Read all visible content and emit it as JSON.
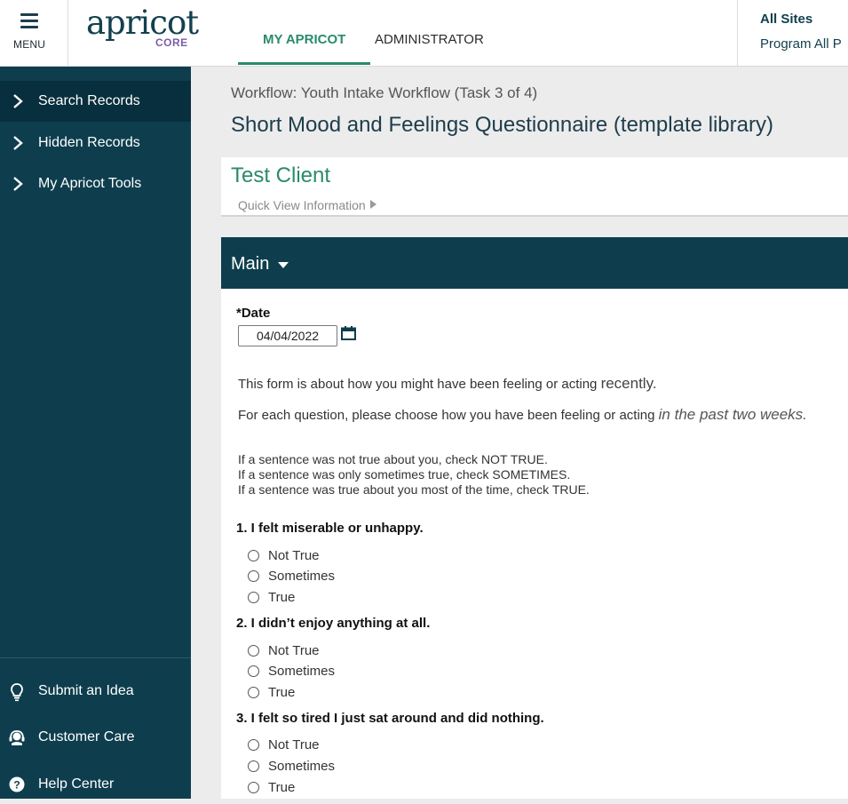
{
  "header": {
    "menu_label": "MENU",
    "logo_word": "apricot",
    "logo_sub": "CORE",
    "tabs": [
      {
        "label": "MY APRICOT",
        "active": true
      },
      {
        "label": "ADMINISTRATOR",
        "active": false
      }
    ],
    "site_title": "All Sites",
    "site_subtitle": "Program All P"
  },
  "sidebar": {
    "items": [
      {
        "label": "Search Records"
      },
      {
        "label": "Hidden Records"
      },
      {
        "label": "My Apricot Tools"
      }
    ],
    "bottom": [
      {
        "label": "Submit an Idea",
        "icon": "lightbulb-icon"
      },
      {
        "label": "Customer Care",
        "icon": "headset-icon"
      },
      {
        "label": "Help Center",
        "icon": "help-icon"
      }
    ]
  },
  "main": {
    "workflow": "Workflow: Youth Intake Workflow (Task 3 of 4)",
    "title": "Short Mood and Feelings Questionnaire (template library)",
    "client_name": "Test Client",
    "quick_view": "Quick View Information",
    "section_title": "Main",
    "date_label": "*Date",
    "date_value": "04/04/2022",
    "intro_1a": "This form is about how you might have been feeling or acting ",
    "intro_1b": "recently.",
    "intro_2a": "For each question, please choose how you have been feeling or acting ",
    "intro_2b": "in the past two weeks.",
    "rules": [
      "If a sentence was not true about you, check NOT TRUE.",
      "If a sentence was only sometimes true, check SOMETIMES.",
      "If a sentence was true about you most of the time, check TRUE."
    ],
    "questions": [
      {
        "title": "1. I felt miserable or unhappy.",
        "options": [
          "Not True",
          "Sometimes",
          "True"
        ]
      },
      {
        "title": "2. I didn’t enjoy anything at all.",
        "options": [
          "Not True",
          "Sometimes",
          "True"
        ]
      },
      {
        "title": "3. I felt so tired I just sat around and did nothing.",
        "options": [
          "Not True",
          "Sometimes",
          "True"
        ]
      }
    ]
  },
  "colors": {
    "sidebar_bg": "#0e3e4e",
    "accent_green": "#2a8a6d",
    "logo_purple": "#7a5ea8"
  }
}
